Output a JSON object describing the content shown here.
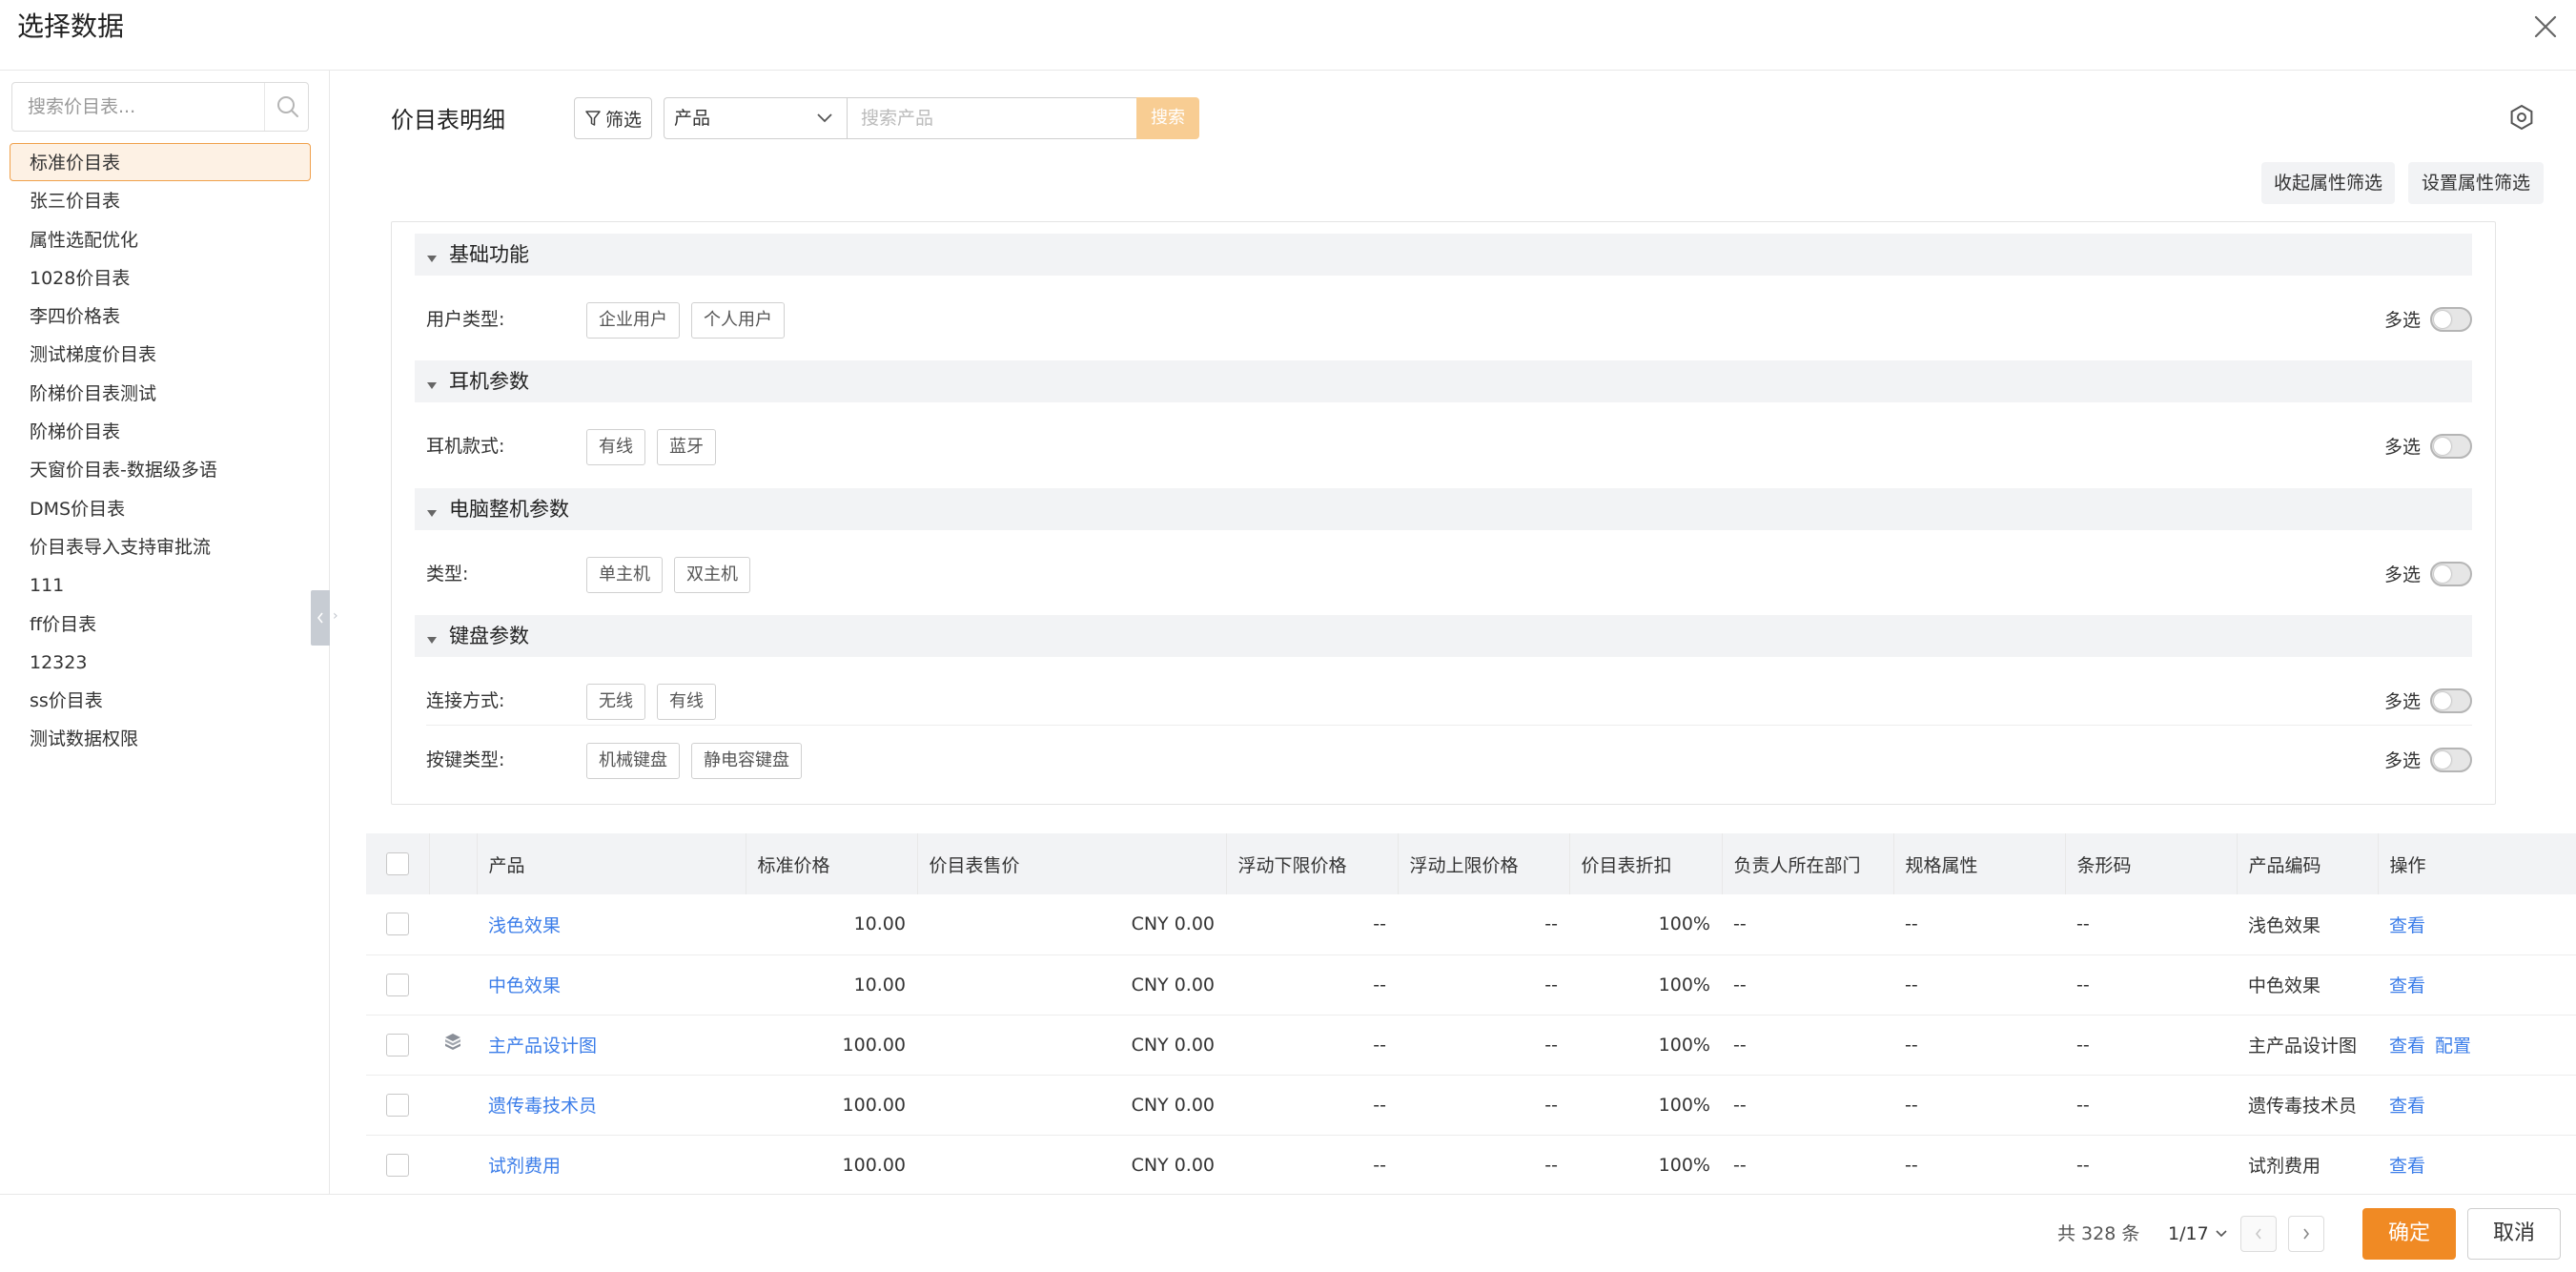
{
  "dialog": {
    "title": "选择数据"
  },
  "sidebar": {
    "search_placeholder": "搜索价目表...",
    "items": [
      "标准价目表",
      "张三价目表",
      "属性选配优化",
      "1028价目表",
      "李四价格表",
      "测试梯度价目表",
      "阶梯价目表测试",
      "阶梯价目表",
      "天窗价目表-数据级多语",
      "DMS价目表",
      "价目表导入支持审批流",
      "111",
      "ff价目表",
      "12323",
      "ss价目表",
      "测试数据权限"
    ],
    "active_index": 0
  },
  "toolbar": {
    "title": "价目表明细",
    "filter_label": "筛选",
    "product_select": "产品",
    "search_placeholder": "搜索产品",
    "search_label": "搜索",
    "collapse_label": "收起属性筛选",
    "settings_label": "设置属性筛选"
  },
  "filters": {
    "multi_label": "多选",
    "groups": [
      {
        "title": "基础功能",
        "rows": [
          {
            "label": "用户类型:",
            "options": [
              "企业用户",
              "个人用户"
            ]
          }
        ]
      },
      {
        "title": "耳机参数",
        "rows": [
          {
            "label": "耳机款式:",
            "options": [
              "有线",
              "蓝牙"
            ]
          }
        ]
      },
      {
        "title": "电脑整机参数",
        "rows": [
          {
            "label": "类型:",
            "options": [
              "单主机",
              "双主机"
            ]
          }
        ]
      },
      {
        "title": "键盘参数",
        "rows": [
          {
            "label": "连接方式:",
            "options": [
              "无线",
              "有线"
            ]
          },
          {
            "label": "按键类型:",
            "options": [
              "机械键盘",
              "静电容键盘"
            ]
          }
        ]
      }
    ]
  },
  "table": {
    "columns": [
      "产品",
      "标准价格",
      "价目表售价",
      "浮动下限价格",
      "浮动上限价格",
      "价目表折扣",
      "负责人所在部门",
      "规格属性",
      "条形码",
      "产品编码",
      "操作"
    ],
    "rows": [
      {
        "product": "浅色效果",
        "std_price": "10.00",
        "sale_price": "CNY 0.00",
        "floor": "--",
        "ceiling": "--",
        "discount": "100%",
        "dept": "--",
        "spec": "--",
        "barcode": "--",
        "code": "浅色效果",
        "ops": [
          "查看"
        ],
        "has_icon": false
      },
      {
        "product": "中色效果",
        "std_price": "10.00",
        "sale_price": "CNY 0.00",
        "floor": "--",
        "ceiling": "--",
        "discount": "100%",
        "dept": "--",
        "spec": "--",
        "barcode": "--",
        "code": "中色效果",
        "ops": [
          "查看"
        ],
        "has_icon": false
      },
      {
        "product": "主产品设计图",
        "std_price": "100.00",
        "sale_price": "CNY 0.00",
        "floor": "--",
        "ceiling": "--",
        "discount": "100%",
        "dept": "--",
        "spec": "--",
        "barcode": "--",
        "code": "主产品设计图",
        "ops": [
          "查看",
          "配置"
        ],
        "has_icon": true
      },
      {
        "product": "遗传毒技术员",
        "std_price": "100.00",
        "sale_price": "CNY 0.00",
        "floor": "--",
        "ceiling": "--",
        "discount": "100%",
        "dept": "--",
        "spec": "--",
        "barcode": "--",
        "code": "遗传毒技术员",
        "ops": [
          "查看"
        ],
        "has_icon": false
      },
      {
        "product": "试剂费用",
        "std_price": "100.00",
        "sale_price": "CNY 0.00",
        "floor": "--",
        "ceiling": "--",
        "discount": "100%",
        "dept": "--",
        "spec": "--",
        "barcode": "--",
        "code": "试剂费用",
        "ops": [
          "查看"
        ],
        "has_icon": false
      }
    ]
  },
  "footer": {
    "total": "共 328 条",
    "page": "1/17",
    "ok_label": "确定",
    "cancel_label": "取消"
  },
  "colors": {
    "accent": "#f08a24",
    "link": "#3b7de9",
    "search_button": "#f8cd93",
    "active_item_bg": "#fdf1e4"
  }
}
